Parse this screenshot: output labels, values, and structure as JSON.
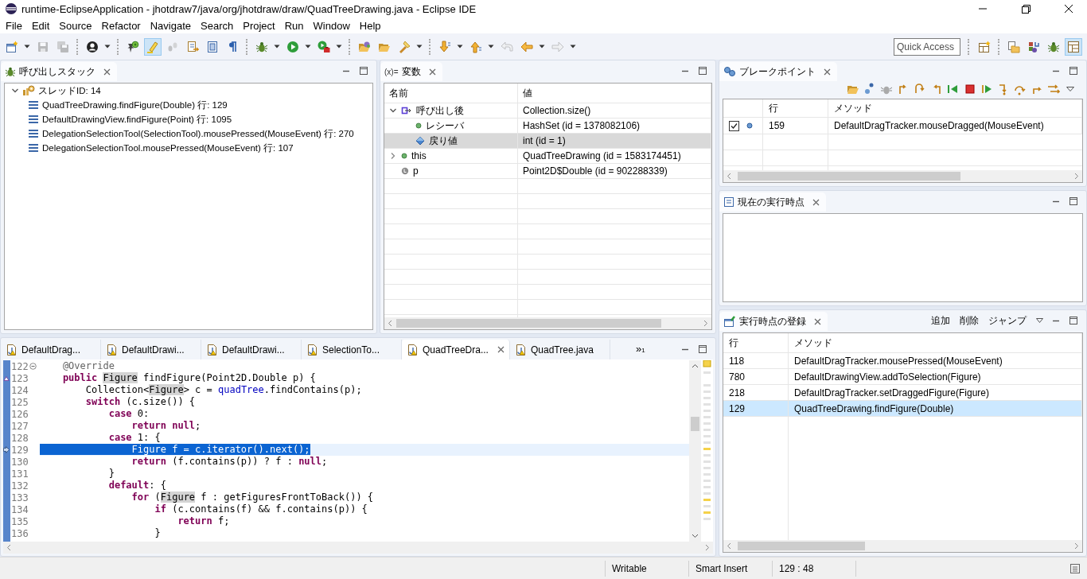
{
  "window": {
    "title": "runtime-EclipseApplication - jhotdraw7/java/org/jhotdraw/draw/QuadTreeDrawing.java - Eclipse IDE"
  },
  "menu": [
    "File",
    "Edit",
    "Source",
    "Refactor",
    "Navigate",
    "Search",
    "Project",
    "Run",
    "Window",
    "Help"
  ],
  "toolbar": [
    {
      "kind": "dropdown",
      "selected": false,
      "disabled": false
    },
    {
      "kind": "button",
      "selected": false,
      "disabled": true
    },
    {
      "kind": "button",
      "selected": false,
      "disabled": true
    },
    {
      "kind": "separator"
    },
    {
      "kind": "dropdown",
      "selected": false,
      "disabled": false
    },
    {
      "kind": "separator"
    },
    {
      "kind": "button",
      "selected": false,
      "disabled": false
    },
    {
      "kind": "button",
      "selected": true,
      "disabled": false
    },
    {
      "kind": "button",
      "selected": false,
      "disabled": true
    },
    {
      "kind": "button",
      "selected": false,
      "disabled": false
    },
    {
      "kind": "button",
      "selected": false,
      "disabled": false
    },
    {
      "kind": "button",
      "selected": false,
      "disabled": false
    },
    {
      "kind": "separator"
    },
    {
      "kind": "dropdown",
      "selected": false,
      "disabled": false
    },
    {
      "kind": "dropdown",
      "selected": false,
      "disabled": false
    },
    {
      "kind": "dropdown",
      "selected": false,
      "disabled": false
    },
    {
      "kind": "separator"
    },
    {
      "kind": "button",
      "selected": false,
      "disabled": false
    },
    {
      "kind": "button",
      "selected": false,
      "disabled": false
    },
    {
      "kind": "dropdown",
      "selected": false,
      "disabled": false
    },
    {
      "kind": "separator"
    },
    {
      "kind": "dropdown",
      "selected": false,
      "disabled": false
    },
    {
      "kind": "dropdown",
      "selected": false,
      "disabled": false
    },
    {
      "kind": "button",
      "selected": false,
      "disabled": true
    },
    {
      "kind": "dropdown",
      "selected": false,
      "disabled": false
    },
    {
      "kind": "dropdown",
      "selected": false,
      "disabled": true
    }
  ],
  "quick_access": {
    "placeholder": "Quick Access"
  },
  "perspectives": [
    {
      "selected": false
    },
    {
      "selected": false
    },
    {
      "selected": false
    },
    {
      "selected": false
    },
    {
      "selected": true
    }
  ],
  "call_stack": {
    "title": "呼び出しスタック",
    "thread": {
      "label": "スレッドID: 14",
      "expanded": true,
      "frames": [
        "QuadTreeDrawing.findFigure(Double) 行: 129",
        "DefaultDrawingView.findFigure(Point) 行: 1095",
        "DelegationSelectionTool(SelectionTool).mousePressed(MouseEvent) 行: 270",
        "DelegationSelectionTool.mousePressed(MouseEvent) 行: 107"
      ]
    }
  },
  "variables": {
    "icon_text": "(x)=",
    "title": "変数",
    "columns": [
      "名前",
      "値"
    ],
    "rows": [
      {
        "kind": "method-result",
        "name": "呼び出し後",
        "value": "Collection.size()",
        "expanded": true,
        "selected": false,
        "children": [
          {
            "kind": "field",
            "name": "レシーバ",
            "value": "HashSet (id = 1378082106)",
            "selected": false
          },
          {
            "kind": "return",
            "name": "戻り値",
            "value": "int (id = 1)",
            "selected": true
          }
        ]
      },
      {
        "kind": "field",
        "name": "this",
        "value": "QuadTreeDrawing (id = 1583174451)",
        "expanded": false,
        "selected": false
      },
      {
        "kind": "local",
        "name": "p",
        "value": "Point2D$Double (id = 902288339)",
        "selected": false
      }
    ]
  },
  "editor": {
    "tabs": [
      {
        "label": "DefaultDrag...",
        "selected": false
      },
      {
        "label": "DefaultDrawi...",
        "selected": false
      },
      {
        "label": "DefaultDrawi...",
        "selected": false
      },
      {
        "label": "SelectionTo...",
        "selected": false
      },
      {
        "label": "QuadTreeDra...",
        "selected": true
      },
      {
        "label": "QuadTree.java",
        "selected": false
      }
    ],
    "overflow": "»",
    "overflow_count": "1",
    "lines": [
      {
        "number": "122",
        "kind": "fold",
        "current": false,
        "selected": false,
        "segments": [
          {
            "kind": "annotation",
            "text": "    @Override"
          }
        ]
      },
      {
        "number": "123",
        "kind": "override",
        "current": false,
        "selected": false,
        "segments": [
          {
            "kind": "keyword",
            "text": "    public "
          },
          {
            "kind": "occurrence",
            "text": "Figure"
          },
          {
            "kind": "plain",
            "text": " findFigure(Point2D.Double p) {"
          }
        ]
      },
      {
        "number": "124",
        "kind": "plain",
        "current": false,
        "selected": false,
        "segments": [
          {
            "kind": "plain",
            "text": "        Collection<"
          },
          {
            "kind": "occurrence",
            "text": "Figure"
          },
          {
            "kind": "plain",
            "text": "> c = "
          },
          {
            "kind": "field",
            "text": "quadTree"
          },
          {
            "kind": "plain",
            "text": ".findContains(p);"
          }
        ]
      },
      {
        "number": "125",
        "kind": "plain",
        "current": false,
        "selected": false,
        "segments": [
          {
            "kind": "keyword",
            "text": "        switch"
          },
          {
            "kind": "plain",
            "text": " (c.size()) {"
          }
        ]
      },
      {
        "number": "126",
        "kind": "plain",
        "current": false,
        "selected": false,
        "segments": [
          {
            "kind": "keyword",
            "text": "            case"
          },
          {
            "kind": "plain",
            "text": " 0:"
          }
        ]
      },
      {
        "number": "127",
        "kind": "plain",
        "current": false,
        "selected": false,
        "segments": [
          {
            "kind": "keyword",
            "text": "                return null"
          },
          {
            "kind": "plain",
            "text": ";"
          }
        ]
      },
      {
        "number": "128",
        "kind": "plain",
        "current": false,
        "selected": false,
        "segments": [
          {
            "kind": "keyword",
            "text": "            case"
          },
          {
            "kind": "plain",
            "text": " 1: {"
          }
        ]
      },
      {
        "number": "129",
        "kind": "pointer",
        "current": true,
        "selected": true,
        "segments": [
          {
            "kind": "plain",
            "text": "                Figure f = c.iterator().next();"
          }
        ]
      },
      {
        "number": "130",
        "kind": "plain",
        "current": false,
        "selected": false,
        "segments": [
          {
            "kind": "keyword",
            "text": "                return"
          },
          {
            "kind": "plain",
            "text": " (f.contains(p)) ? f : "
          },
          {
            "kind": "keyword",
            "text": "null"
          },
          {
            "kind": "plain",
            "text": ";"
          }
        ]
      },
      {
        "number": "131",
        "kind": "plain",
        "current": false,
        "selected": false,
        "segments": [
          {
            "kind": "plain",
            "text": "            }"
          }
        ]
      },
      {
        "number": "132",
        "kind": "plain",
        "current": false,
        "selected": false,
        "segments": [
          {
            "kind": "keyword",
            "text": "            default"
          },
          {
            "kind": "plain",
            "text": ": {"
          }
        ]
      },
      {
        "number": "133",
        "kind": "plain",
        "current": false,
        "selected": false,
        "segments": [
          {
            "kind": "keyword",
            "text": "                for"
          },
          {
            "kind": "plain",
            "text": " ("
          },
          {
            "kind": "occurrence",
            "text": "Figure"
          },
          {
            "kind": "plain",
            "text": " f : getFiguresFrontToBack()) {"
          }
        ]
      },
      {
        "number": "134",
        "kind": "plain",
        "current": false,
        "selected": false,
        "segments": [
          {
            "kind": "keyword",
            "text": "                    if"
          },
          {
            "kind": "plain",
            "text": " (c.contains(f) && f.contains(p)) {"
          }
        ]
      },
      {
        "number": "135",
        "kind": "plain",
        "current": false,
        "selected": false,
        "segments": [
          {
            "kind": "keyword",
            "text": "                        return"
          },
          {
            "kind": "plain",
            "text": " f;"
          }
        ]
      },
      {
        "number": "136",
        "kind": "plain",
        "current": false,
        "selected": false,
        "segments": [
          {
            "kind": "plain",
            "text": "                    }"
          }
        ]
      }
    ]
  },
  "breakpoints": {
    "title": "ブレークポイント",
    "columns": [
      "行",
      "メソッド"
    ],
    "rows": [
      {
        "checked": true,
        "line": "159",
        "method": "DefaultDragTracker.mouseDragged(MouseEvent)"
      }
    ]
  },
  "instruction_pointer": {
    "title": "現在の実行時点"
  },
  "registered": {
    "title": "実行時点の登録",
    "actions": [
      "追加",
      "削除",
      "ジャンプ"
    ],
    "columns": [
      "行",
      "メソッド"
    ],
    "rows": [
      {
        "line": "118",
        "method": "DefaultDragTracker.mousePressed(MouseEvent)",
        "selected": false
      },
      {
        "line": "780",
        "method": "DefaultDrawingView.addToSelection(Figure)",
        "selected": false
      },
      {
        "line": "218",
        "method": "DefaultDragTracker.setDraggedFigure(Figure)",
        "selected": false
      },
      {
        "line": "129",
        "method": "QuadTreeDrawing.findFigure(Double)",
        "selected": true
      }
    ]
  },
  "status_bar": [
    "Writable",
    "Smart Insert",
    "129 : 48"
  ]
}
